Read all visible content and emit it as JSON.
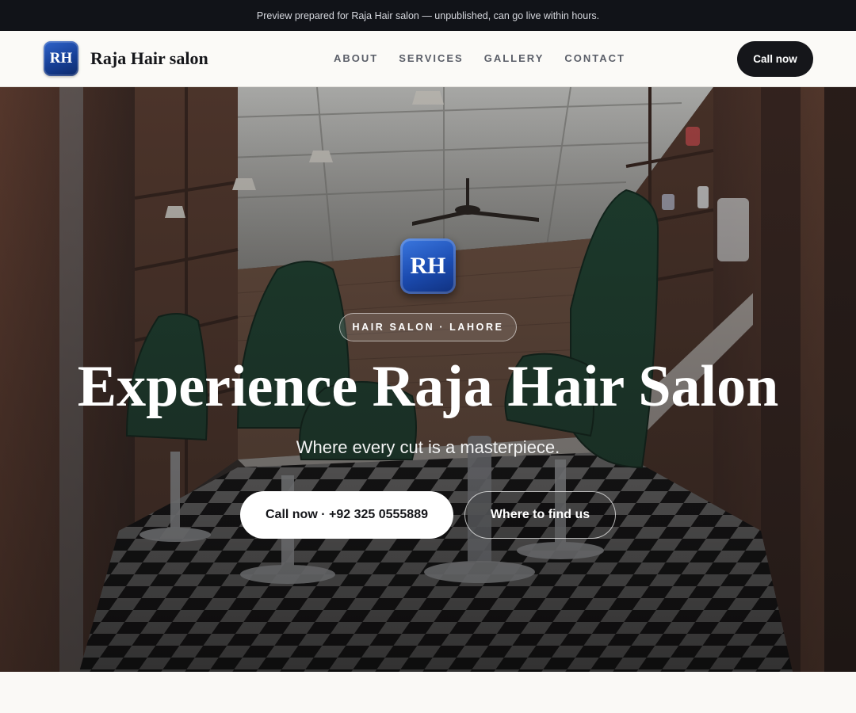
{
  "announcement": "Preview prepared for Raja Hair salon — unpublished, can go live within hours.",
  "brand": {
    "initials": "RH",
    "name": "Raja Hair salon"
  },
  "nav": {
    "items": [
      "ABOUT",
      "SERVICES",
      "GALLERY",
      "CONTACT"
    ],
    "cta_label": "Call now"
  },
  "hero": {
    "logo_initials": "RH",
    "eyebrow": "HAIR SALON · LAHORE",
    "headline": "Experience Raja Hair Salon",
    "subline": "Where every cut is a masterpiece.",
    "primary_cta": "Call now · +92 325 0555889",
    "secondary_cta": "Where to find us",
    "background_image": "barbershop-interior-photo"
  },
  "colors": {
    "topbar_bg": "#111318",
    "logo_blue": "#1b4bb0",
    "dark_button": "#15161a",
    "page_bg": "#faf9f6"
  }
}
